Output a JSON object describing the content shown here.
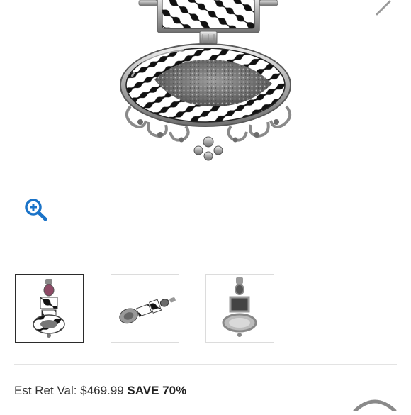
{
  "product_images": {
    "icons": {
      "zoom": "zoom-in-magnifier-icon",
      "next": "chevron-right-icon"
    },
    "thumbnails": [
      {
        "name": "front-view",
        "selected": true
      },
      {
        "name": "side-view",
        "selected": false
      },
      {
        "name": "gemstone-view",
        "selected": false
      }
    ],
    "accent_color": "#1a73c8"
  },
  "pricing": {
    "est_ret_label": "Est Ret Val:",
    "est_ret_value": "$469.99",
    "save_text": "SAVE 70%"
  }
}
